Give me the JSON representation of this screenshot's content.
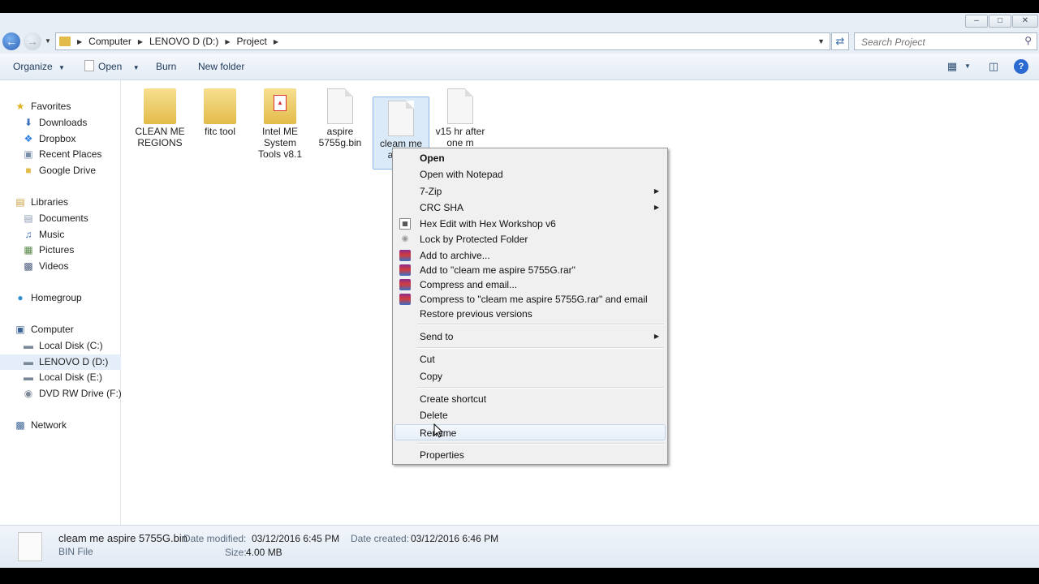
{
  "window": {
    "controls": {
      "minimize": "–",
      "maximize": "□",
      "close": "✕"
    }
  },
  "address": {
    "breadcrumbs": [
      "Computer",
      "LENOVO D (D:)",
      "Project"
    ],
    "search_placeholder": "Search Project"
  },
  "toolbar": {
    "organize": "Organize",
    "open": "Open",
    "burn": "Burn",
    "new_folder": "New folder"
  },
  "sidebar": {
    "favorites": {
      "title": "Favorites",
      "items": [
        "Downloads",
        "Dropbox",
        "Recent Places",
        "Google Drive"
      ]
    },
    "libraries": {
      "title": "Libraries",
      "items": [
        "Documents",
        "Music",
        "Pictures",
        "Videos"
      ]
    },
    "homegroup": "Homegroup",
    "computer": {
      "title": "Computer",
      "items": [
        "Local Disk (C:)",
        "LENOVO D (D:)",
        "Local Disk (E:)",
        "DVD RW Drive (F:) Q"
      ]
    },
    "network": "Network",
    "selected": "LENOVO D (D:)"
  },
  "files": [
    {
      "name": "CLEAN ME REGIONS",
      "lines": [
        "CLEAN ME",
        "REGIONS"
      ],
      "type": "folder"
    },
    {
      "name": "fitc tool",
      "lines": [
        "fitc tool"
      ],
      "type": "folder"
    },
    {
      "name": "Intel ME System Tools v8.1",
      "lines": [
        "Intel ME",
        "System",
        "Tools v8.1"
      ],
      "type": "folder-pdf"
    },
    {
      "name": "aspire 5755g.bin",
      "lines": [
        "aspire",
        "5755g.bin"
      ],
      "type": "file"
    },
    {
      "name": "cleam me aspire 575",
      "lines": [
        "cleam me",
        "aspire",
        "575"
      ],
      "type": "file",
      "selected": true
    },
    {
      "name": "v15 hr after one m",
      "lines": [
        "v15 hr after",
        "one m"
      ],
      "type": "file"
    }
  ],
  "context_menu": {
    "items": [
      {
        "label": "Open",
        "bold": true
      },
      {
        "label": "Open with Notepad"
      },
      {
        "label": "7-Zip",
        "submenu": true
      },
      {
        "label": "CRC SHA",
        "submenu": true
      },
      {
        "label": "Hex Edit with Hex Workshop v6",
        "icon": "hex-workshop-icon"
      },
      {
        "label": "Lock by Protected Folder",
        "icon": "lock-icon"
      },
      {
        "label": "Add to archive...",
        "icon": "winrar-icon"
      },
      {
        "label": "Add to \"cleam me aspire 5755G.rar\"",
        "icon": "winrar-icon"
      },
      {
        "label": "Compress and email...",
        "icon": "winrar-icon"
      },
      {
        "label": "Compress to \"cleam me aspire 5755G.rar\" and email",
        "icon": "winrar-icon"
      },
      {
        "label": "Restore previous versions"
      },
      {
        "label": "Send to",
        "submenu": true
      },
      {
        "label": "Cut"
      },
      {
        "label": "Copy"
      },
      {
        "label": "Create shortcut"
      },
      {
        "label": "Delete"
      },
      {
        "label": "Rename",
        "hovered": true
      },
      {
        "label": "Properties"
      }
    ]
  },
  "details": {
    "filename": "cleam me aspire 5755G.bin",
    "filetype": "BIN File",
    "date_modified_label": "Date modified:",
    "date_modified": "03/12/2016 6:45 PM",
    "date_created_label": "Date created:",
    "date_created": "03/12/2016 6:46 PM",
    "size_label": "Size:",
    "size": "4.00 MB"
  },
  "colors": {
    "selection": "#dbeaf9",
    "folder": "#e3bb4a",
    "toolbar_text": "#1e395b"
  }
}
